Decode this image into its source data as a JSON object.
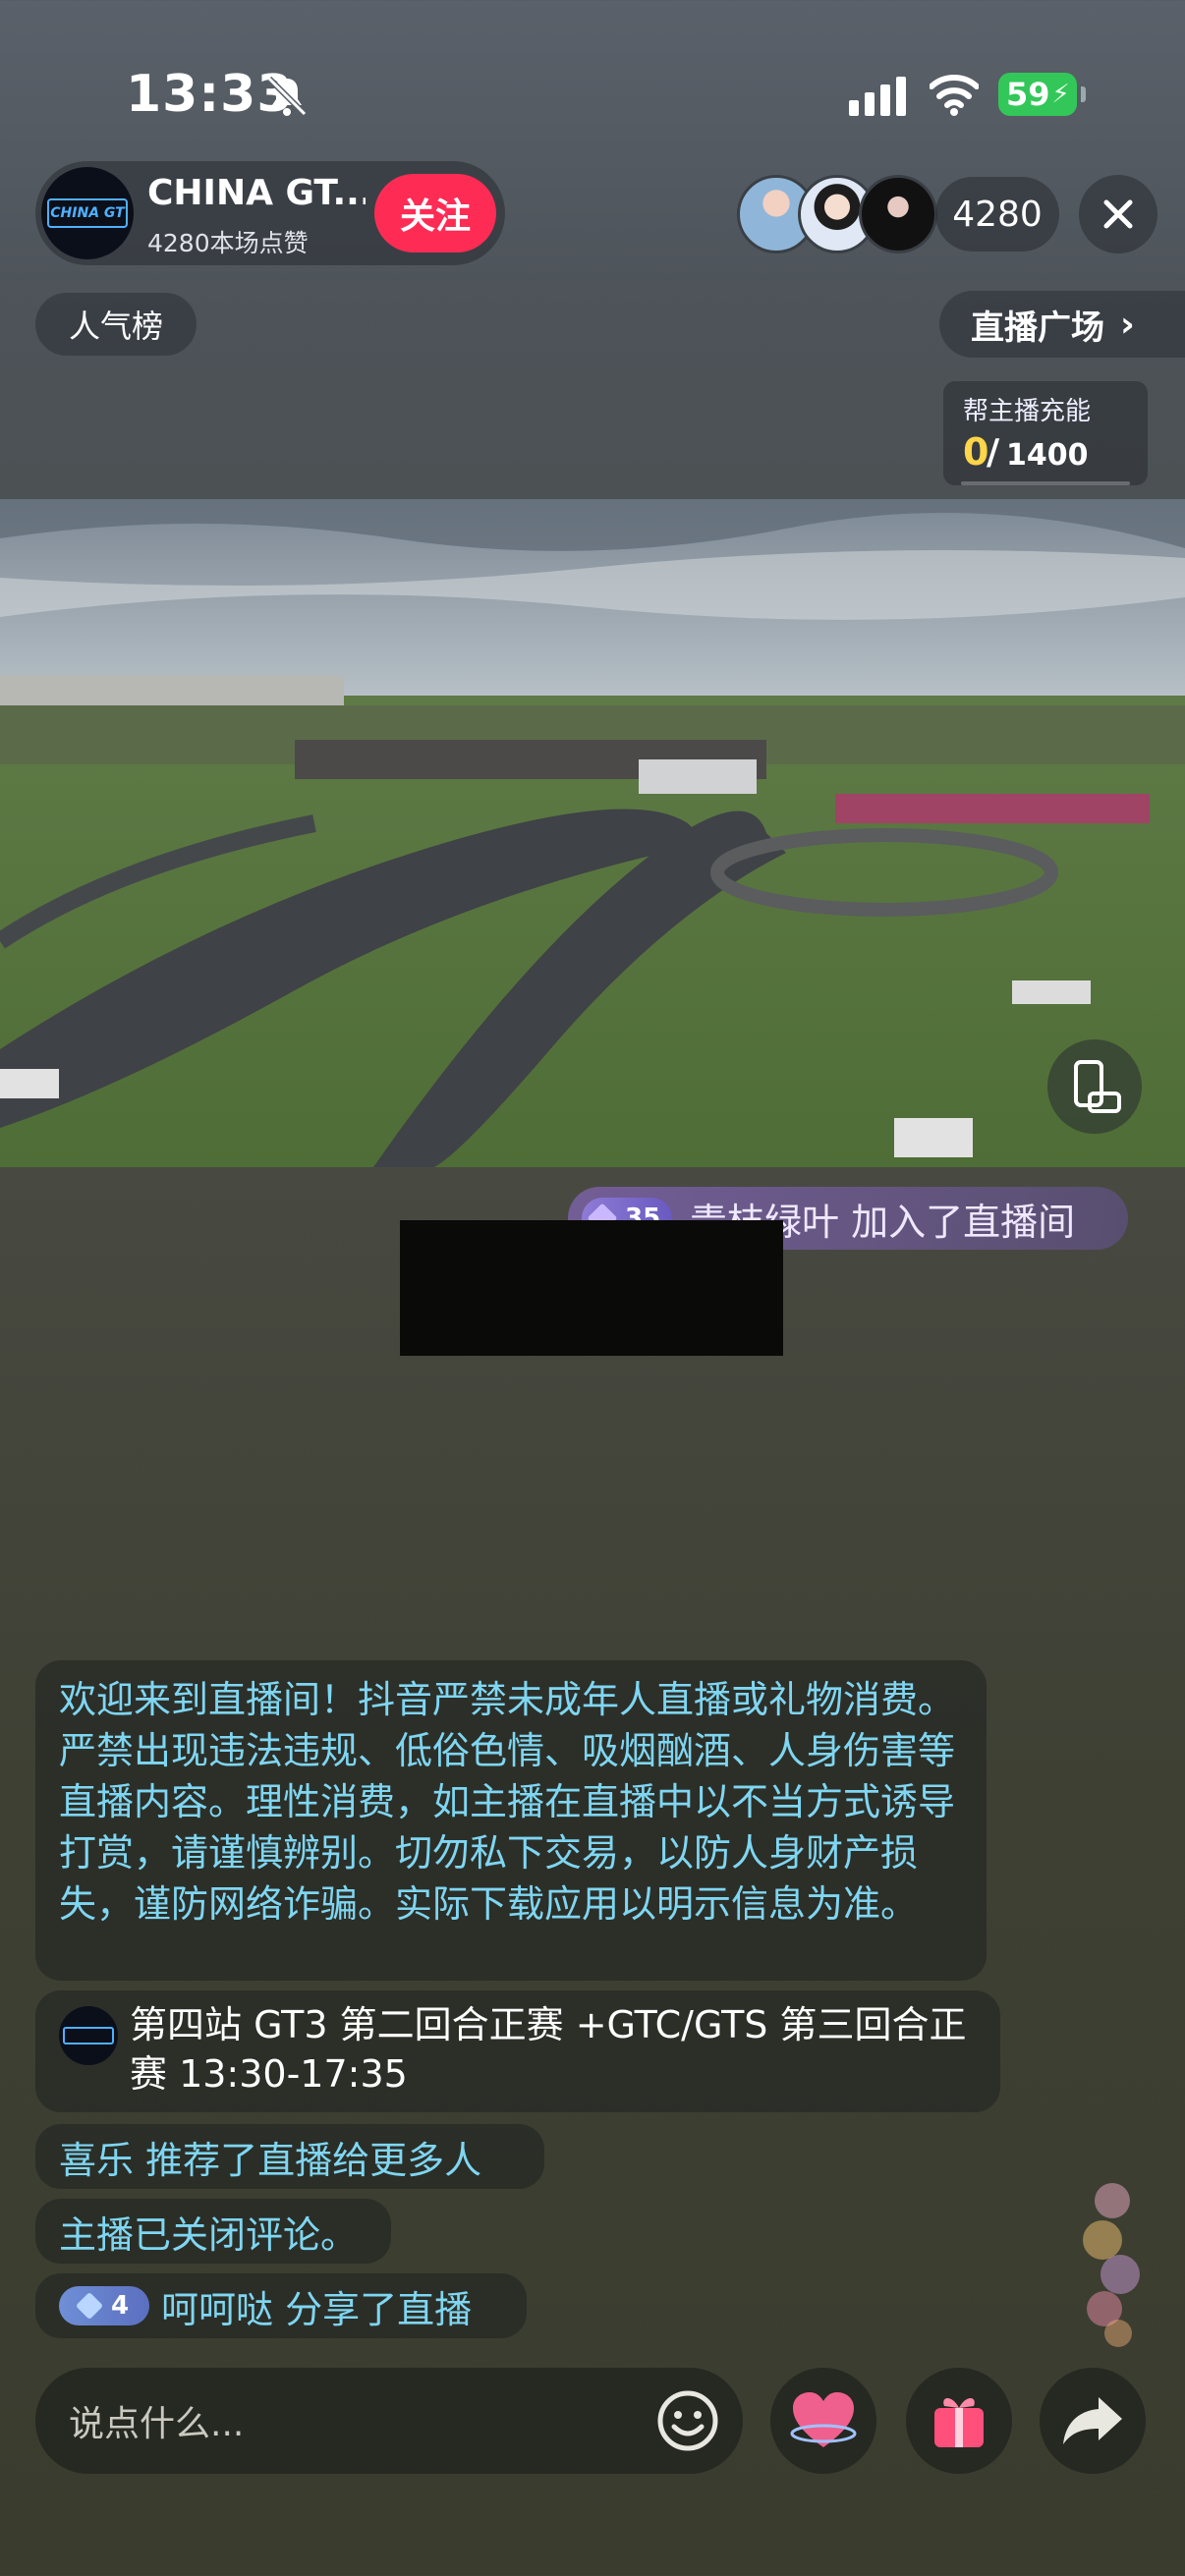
{
  "status_bar": {
    "time": "13:33",
    "battery": "59"
  },
  "host": {
    "name": "CHINA GT...",
    "likes": "4280本场点赞",
    "follow_label": "关注",
    "avatar_logo": "CHINA GT"
  },
  "audience": {
    "count": "4280"
  },
  "rank_label": "人气榜",
  "square_label": "直播广场",
  "charge": {
    "label": "帮主播充能",
    "current": "0",
    "separator": "/",
    "target": "1400"
  },
  "join": {
    "level": "35",
    "text": "青枝绿叶 加入了直播间"
  },
  "chat": {
    "notice": "欢迎来到直播间！抖音严禁未成年人直播或礼物消费。严禁出现违法违规、低俗色情、吸烟酗酒、人身伤害等直播内容。理性消费，如主播在直播中以不当方式诱导打赏，请谨慎辨别。切勿私下交易，以防人身财产损失，谨防网络诈骗。实际下载应用以明示信息为准。",
    "event": "第四站 GT3 第二回合正赛 +GTC/GTS 第三回合正赛 13:30-17:35",
    "recommend": "喜乐 推荐了直播给更多人",
    "comments_closed": "主播已关闭评论。",
    "share_level": "4",
    "share_text": "呵呵哒 分享了直播"
  },
  "input": {
    "placeholder": "说点什么..."
  },
  "colors": {
    "accent": "#fe2c55",
    "chat_text": "#7fd6f2",
    "charge": "#ffd54a",
    "battery": "#33c759"
  }
}
